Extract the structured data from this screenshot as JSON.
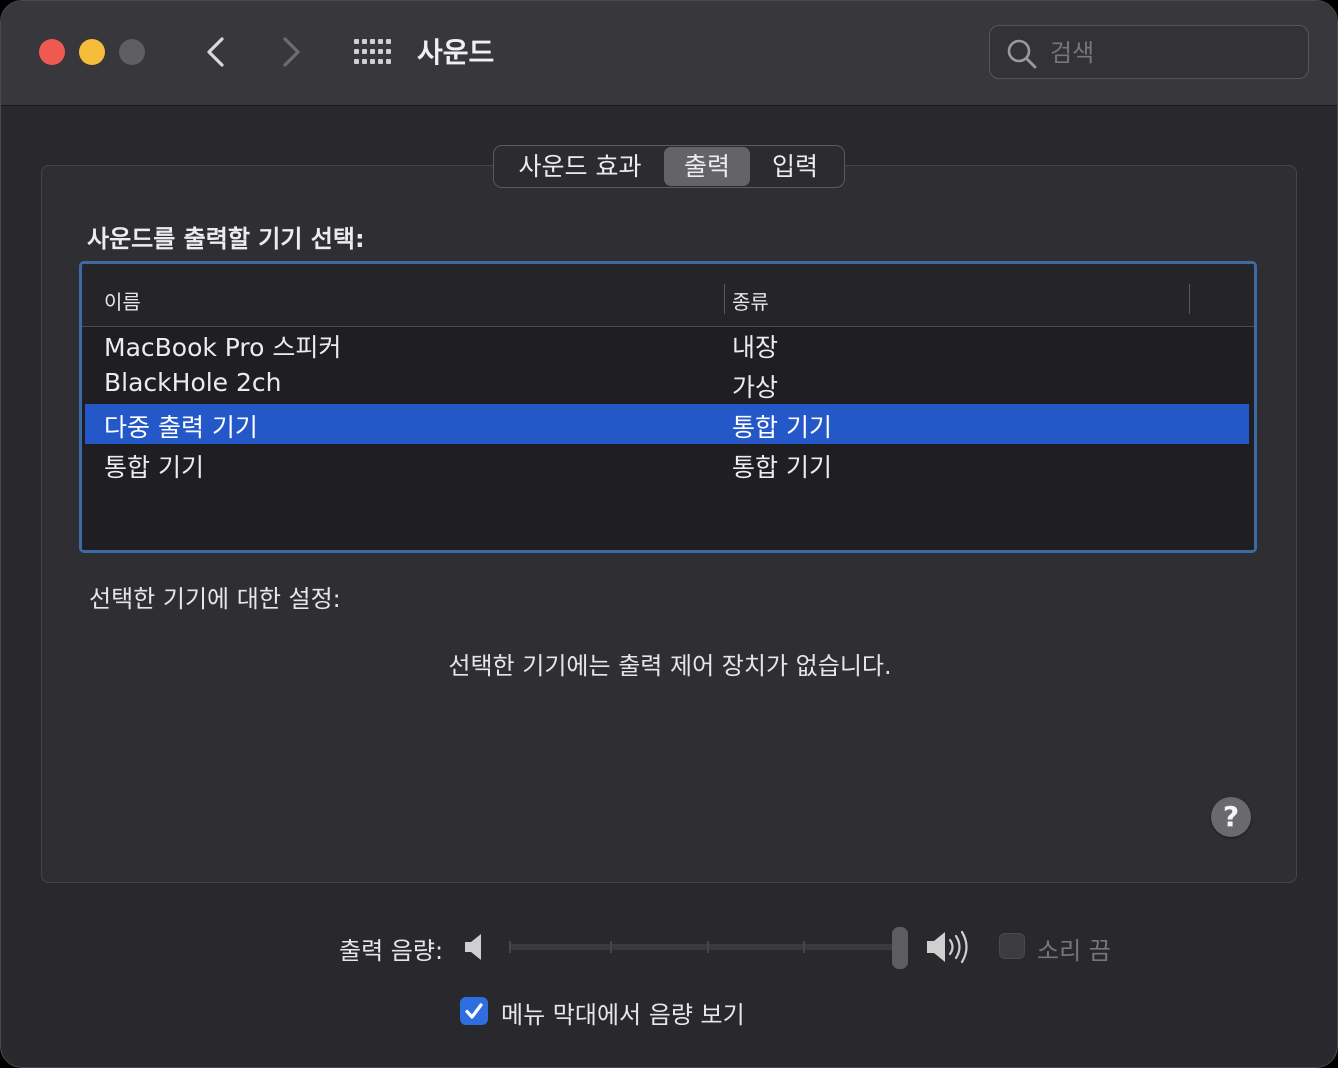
{
  "window": {
    "title": "사운드",
    "search_placeholder": "검색"
  },
  "tabs": [
    {
      "label": "사운드 효과",
      "selected": false
    },
    {
      "label": "출력",
      "selected": true
    },
    {
      "label": "입력",
      "selected": false
    }
  ],
  "output": {
    "select_label": "사운드를 출력할 기기 선택:",
    "columns": [
      "이름",
      "종류"
    ],
    "devices": [
      {
        "name": "MacBook Pro 스피커",
        "type": "내장",
        "selected": false
      },
      {
        "name": "BlackHole 2ch",
        "type": "가상",
        "selected": false
      },
      {
        "name": "다중 출력 기기",
        "type": "통합 기기",
        "selected": true
      },
      {
        "name": "통합 기기",
        "type": "통합 기기",
        "selected": false
      }
    ],
    "settings_label": "선택한 기기에 대한 설정:",
    "no_controls_message": "선택한 기기에는 출력 제어 장치가 없습니다."
  },
  "help": {
    "label": "?"
  },
  "volume": {
    "label": "출력 음량:",
    "level": 1.0,
    "mute_label": "소리 끔",
    "mute_checked": false,
    "mute_enabled": false
  },
  "menubar": {
    "label": "메뉴 막대에서 음량 보기",
    "checked": true
  },
  "colors": {
    "selection": "#2457c8",
    "close": "#ee5a51",
    "minimize": "#f4bd3a",
    "checkbox_on": "#2f6ee0"
  }
}
